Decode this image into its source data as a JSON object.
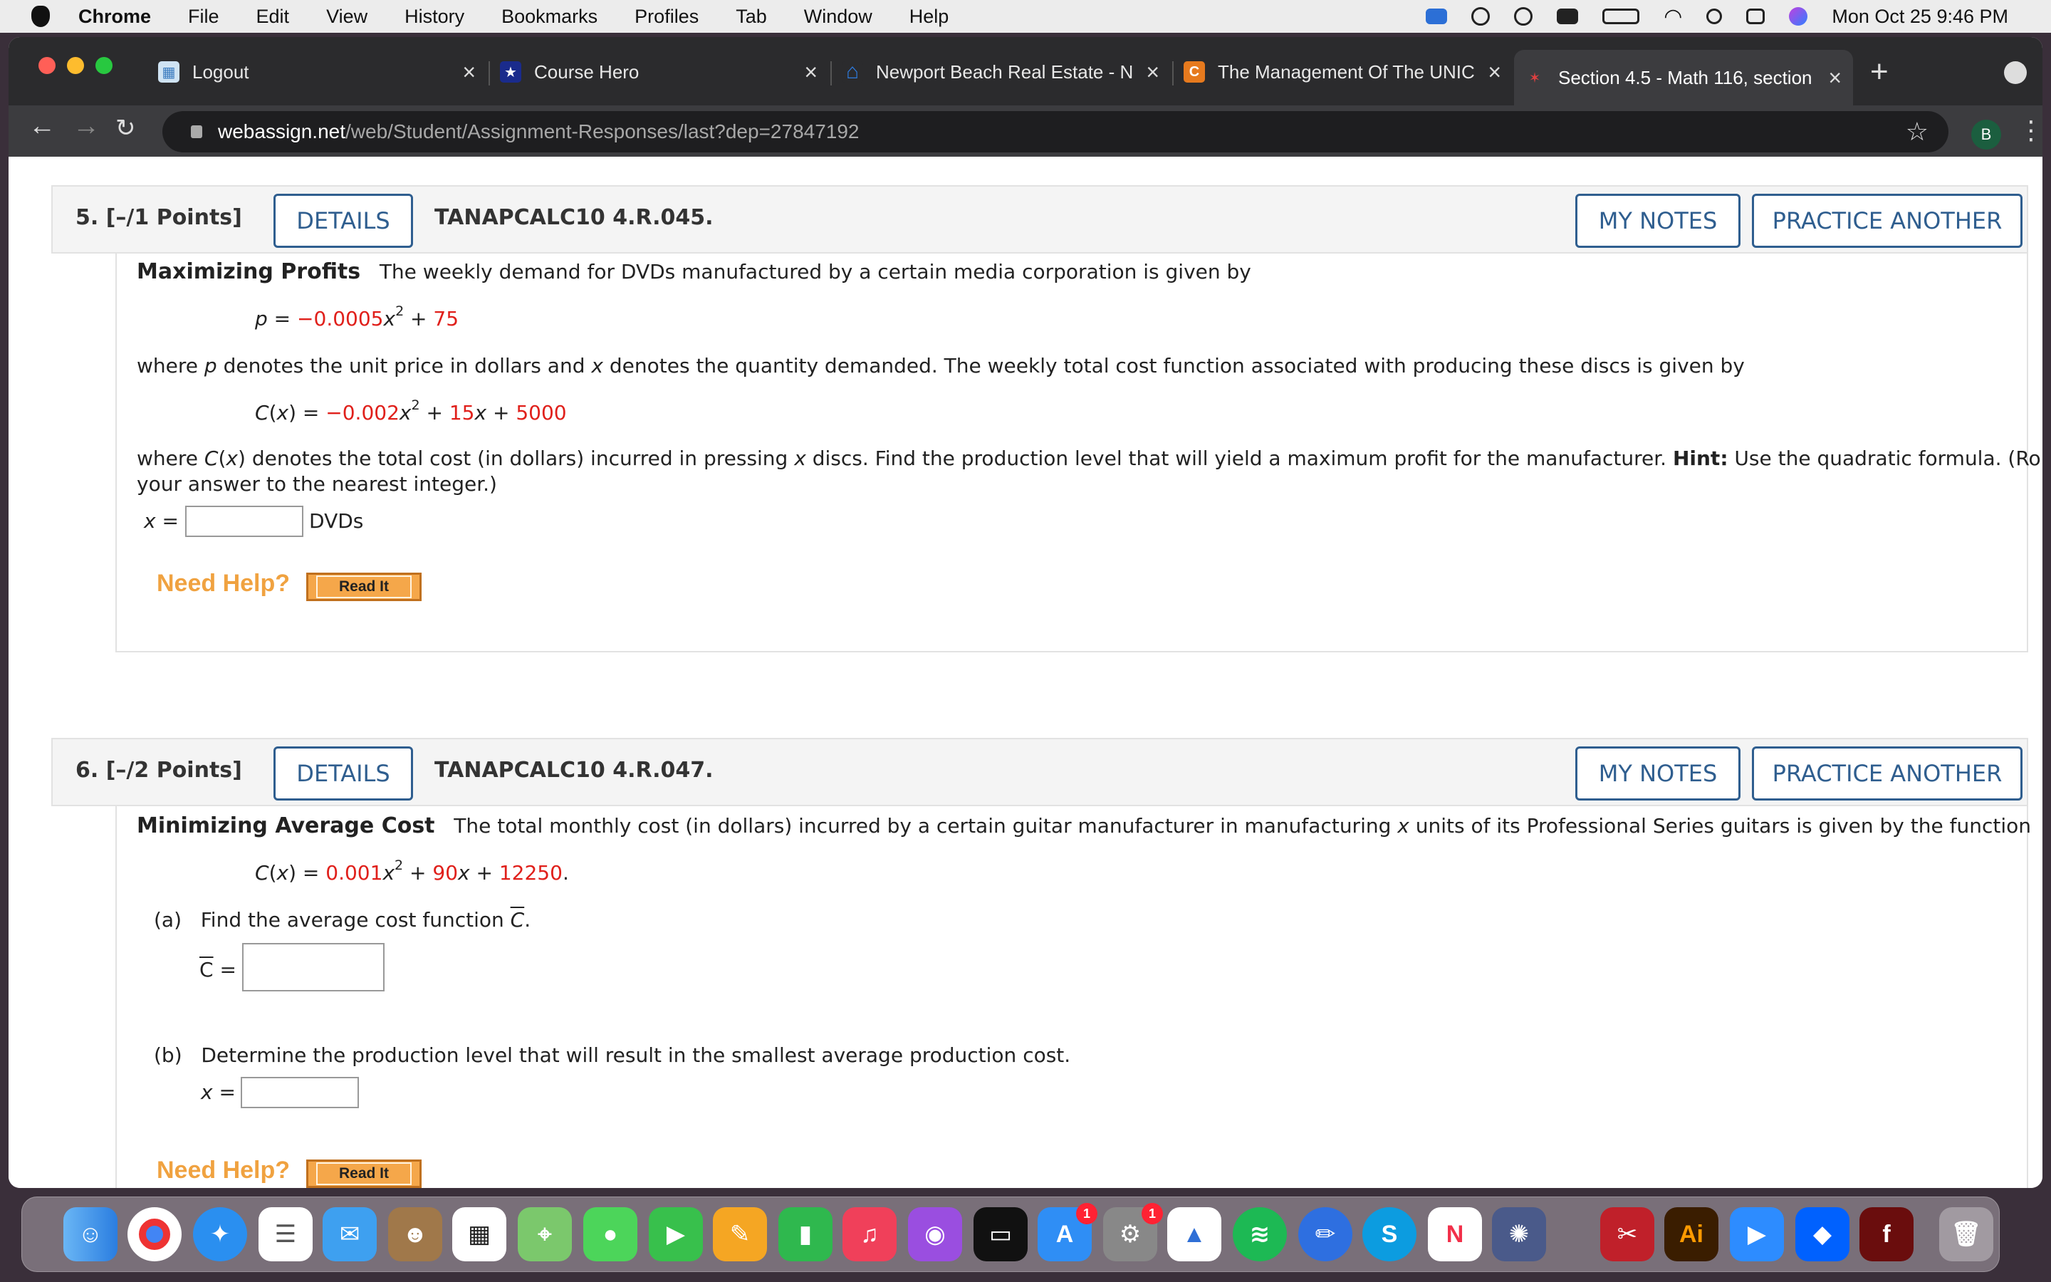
{
  "menubar": {
    "items": [
      "Chrome",
      "File",
      "Edit",
      "View",
      "History",
      "Bookmarks",
      "Profiles",
      "Tab",
      "Window",
      "Help"
    ],
    "clock": "Mon Oct 25  9:46 PM"
  },
  "tabs": [
    {
      "label": "Logout",
      "favicon": "grid-icon",
      "close": "×"
    },
    {
      "label": "Course Hero",
      "favicon": "star-icon",
      "close": "×"
    },
    {
      "label": "Newport Beach Real Estate - N",
      "favicon": "house-icon",
      "close": "×"
    },
    {
      "label": "The Management Of The UNIC",
      "favicon": "c-letter-icon",
      "close": "×"
    },
    {
      "label": "Section 4.5 - Math 116, section",
      "favicon": "webassign-icon",
      "close": "×",
      "active": true
    }
  ],
  "toolbar": {
    "url_host": "webassign.net",
    "url_path": "/web/Student/Assignment-Responses/last?dep=27847192",
    "profile_initial": "B",
    "new_tab": "+"
  },
  "questions": {
    "q5": {
      "number": "5.  [–/1 Points]",
      "details_label": "DETAILS",
      "code": "TANAPCALC10 4.R.045.",
      "notes_label": "MY NOTES",
      "practice_label": "PRACTICE ANOTHER",
      "title": "Maximizing Profits",
      "intro": "The weekly demand for DVDs manufactured by a certain media corporation is given by",
      "demand_coef": "−0.0005",
      "demand_const": "75",
      "where1": "denotes the unit price in dollars and",
      "where1b": "denotes the quantity demanded. The weekly total cost function associated with producing these discs is given by",
      "cost_a": "−0.002",
      "cost_b": "15",
      "cost_c": "5000",
      "where2a": "denotes the total cost (in dollars) incurred in pressing",
      "where2b": "discs. Find the production level that will yield a maximum profit for the manufacturer.",
      "hint_label": "Hint:",
      "hint_text": "Use the quadratic formula. (Round",
      "hint_line2": "your answer to the nearest integer.)",
      "answer_value": "",
      "answer_unit": "DVDs",
      "need_help": "Need Help?",
      "read_it": "Read It"
    },
    "q6": {
      "number": "6.  [–/2 Points]",
      "details_label": "DETAILS",
      "code": "TANAPCALC10 4.R.047.",
      "notes_label": "MY NOTES",
      "practice_label": "PRACTICE ANOTHER",
      "title": "Minimizing Average Cost",
      "intro": "The total monthly cost (in dollars) incurred by a certain guitar manufacturer in manufacturing",
      "intro_b": "units of its Professional Series guitars is given by the function",
      "cost_a": "0.001",
      "cost_b": "90",
      "cost_c": "12250",
      "part_a_label": "(a)",
      "part_a_text": "Find the average cost function",
      "part_a_value": "",
      "part_b_label": "(b)",
      "part_b_text": "Determine the production level that will result in the smallest average production cost.",
      "part_b_value": "",
      "need_help": "Need Help?",
      "read_it": "Read It"
    }
  }
}
